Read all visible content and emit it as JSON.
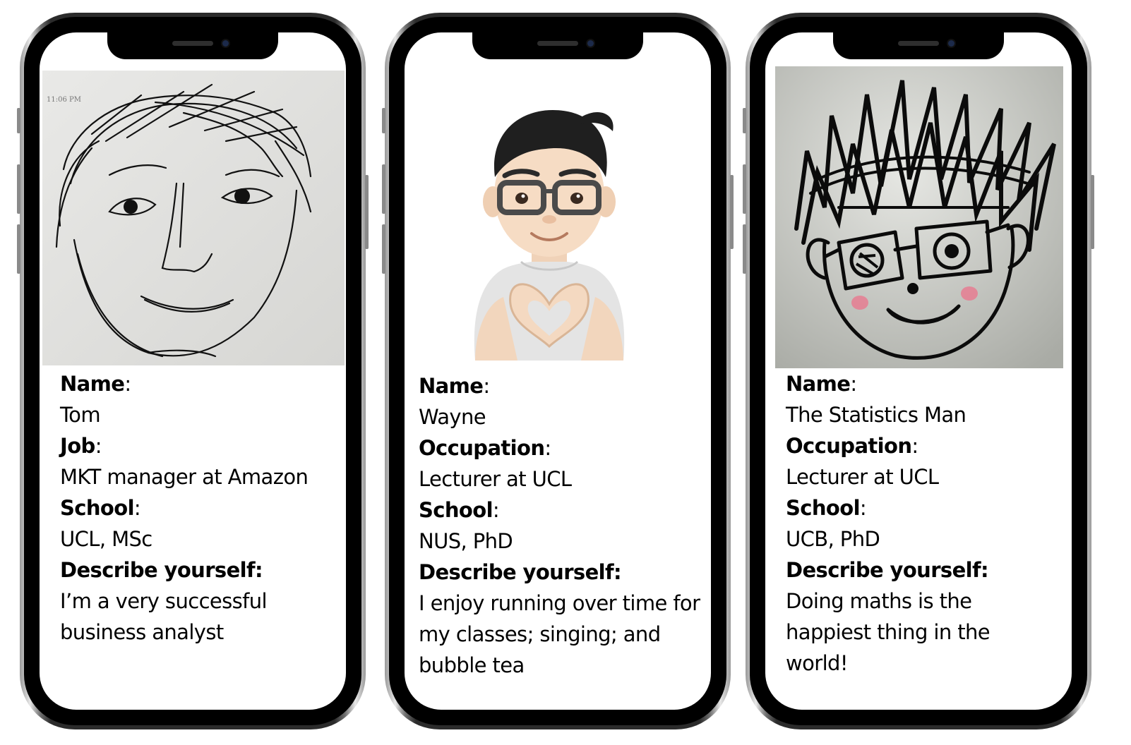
{
  "cards": [
    {
      "portrait": "sketch-portrait-tom",
      "timestamp": "11:06 PM",
      "fields": [
        {
          "label": "Name",
          "colon": ":",
          "value": "Tom"
        },
        {
          "label": "Job",
          "colon": ":",
          "value": "MKT manager at Amazon"
        },
        {
          "label": "School",
          "colon": ":",
          "value": "UCL, MSc"
        },
        {
          "label": "Describe yourself:",
          "colon": "",
          "value": "I’m a very successful business analyst"
        }
      ]
    },
    {
      "portrait": "memoji-avatar-wayne",
      "fields": [
        {
          "label": "Name",
          "colon": ":",
          "value": "Wayne"
        },
        {
          "label": "Occupation",
          "colon": ":",
          "value": "Lecturer at UCL"
        },
        {
          "label": "School",
          "colon": ":",
          "value": "NUS, PhD"
        },
        {
          "label": "Describe yourself:",
          "colon": "",
          "value": "I enjoy running over time for my classes; singing; and bubble tea"
        }
      ]
    },
    {
      "portrait": "sketch-portrait-statistics-man",
      "fields": [
        {
          "label": "Name",
          "colon": ":",
          "value": "The Statistics Man"
        },
        {
          "label": "Occupation",
          "colon": ":",
          "value": "Lecturer at UCL"
        },
        {
          "label": "School",
          "colon": ":",
          "value": "UCB, PhD"
        },
        {
          "label": "Describe yourself:",
          "colon": "",
          "value": "Doing maths is the happiest thing in the world!"
        }
      ]
    }
  ],
  "colors": {
    "frame": "#000000",
    "screen": "#ffffff",
    "text": "#000000",
    "blush": "#e8788f"
  }
}
